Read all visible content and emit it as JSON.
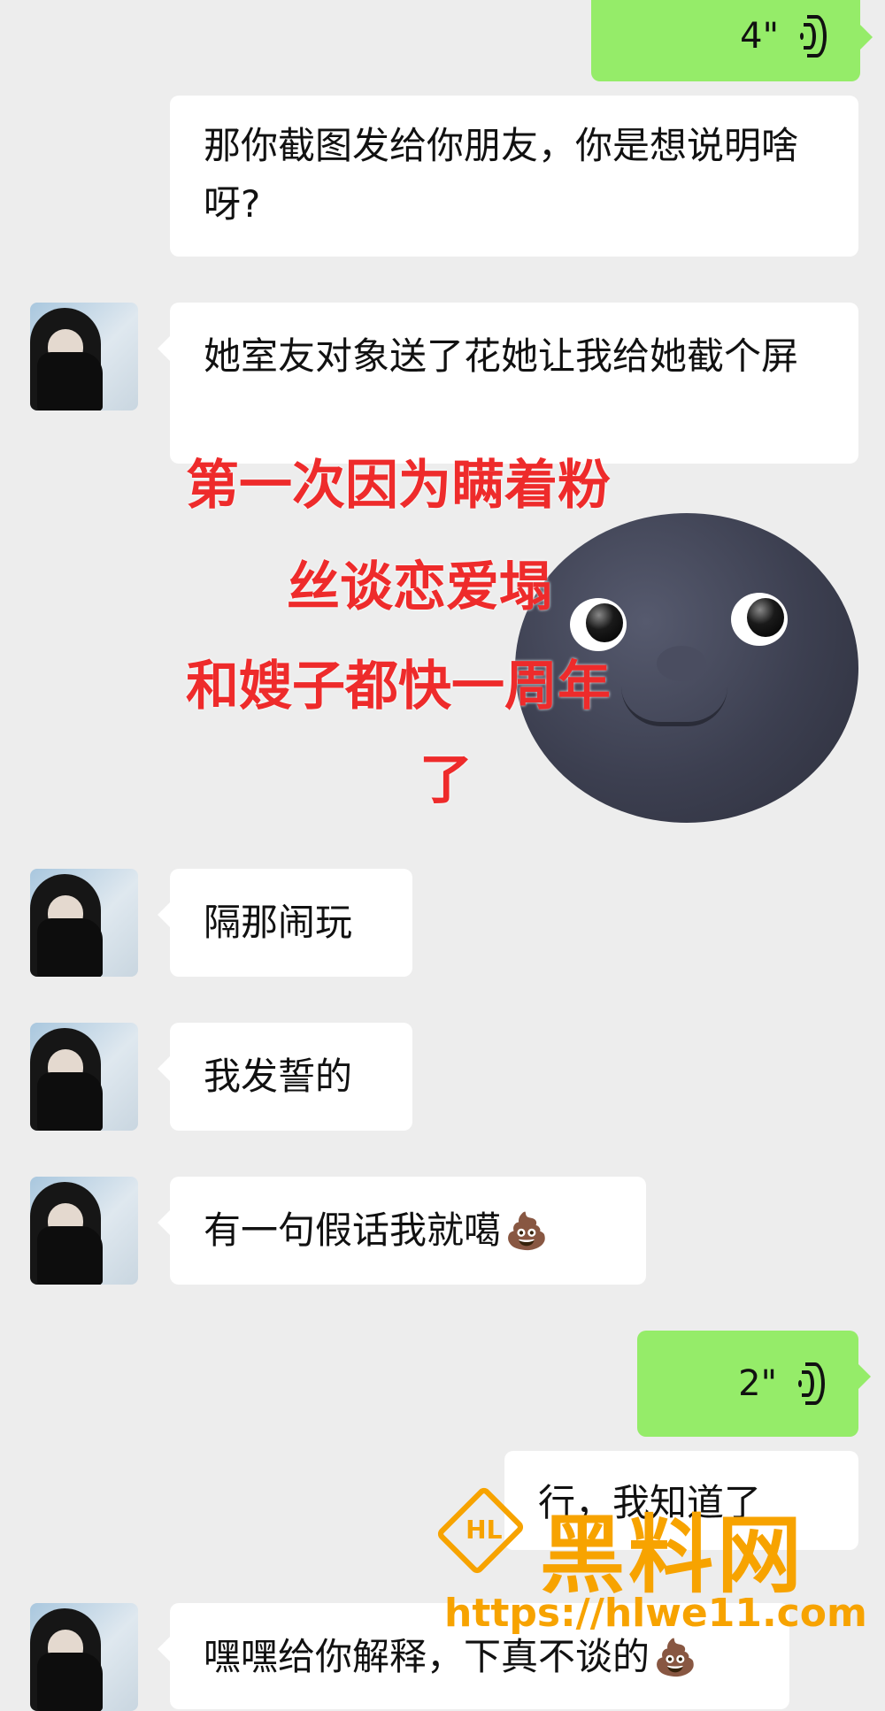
{
  "messages": [
    {
      "side": "out",
      "type": "voice",
      "duration": "4\""
    },
    {
      "side": "in",
      "type": "text",
      "text": "那你截图发给你朋友，你是想说明啥呀?"
    },
    {
      "side": "in",
      "type": "text",
      "text": "她室友对象送了花她让我给她截个屏"
    },
    {
      "side": "in",
      "type": "text",
      "text": "隔那闹玩"
    },
    {
      "side": "in",
      "type": "text",
      "text": "我发誓的"
    },
    {
      "side": "in",
      "type": "text",
      "text": "有一句假话我就噶",
      "emoji": "💩"
    },
    {
      "side": "out",
      "type": "voice",
      "duration": "2\""
    },
    {
      "side": "out",
      "type": "text",
      "text": "行，我知道了"
    },
    {
      "side": "in",
      "type": "text",
      "text": "嘿嘿给你解释，下真不谈的",
      "emoji": "💩"
    }
  ],
  "overlay": {
    "lines": [
      "第一次因为瞒着粉",
      "丝谈恋爱塌",
      "和嫂子都快一周年",
      "了"
    ],
    "sticker": "moon-face-sticker",
    "color": "#ee2b2b"
  },
  "watermark": {
    "logo_text": "HL",
    "title": "黑料网",
    "url": "https://hlwe11.com",
    "color": "#f7a300"
  },
  "colors": {
    "background": "#ededed",
    "incoming_bubble": "#ffffff",
    "outgoing_voice_bubble": "#95ec69"
  },
  "icons": {
    "voice": "voice-wave-icon",
    "avatar": "hooded-person-avatar"
  }
}
